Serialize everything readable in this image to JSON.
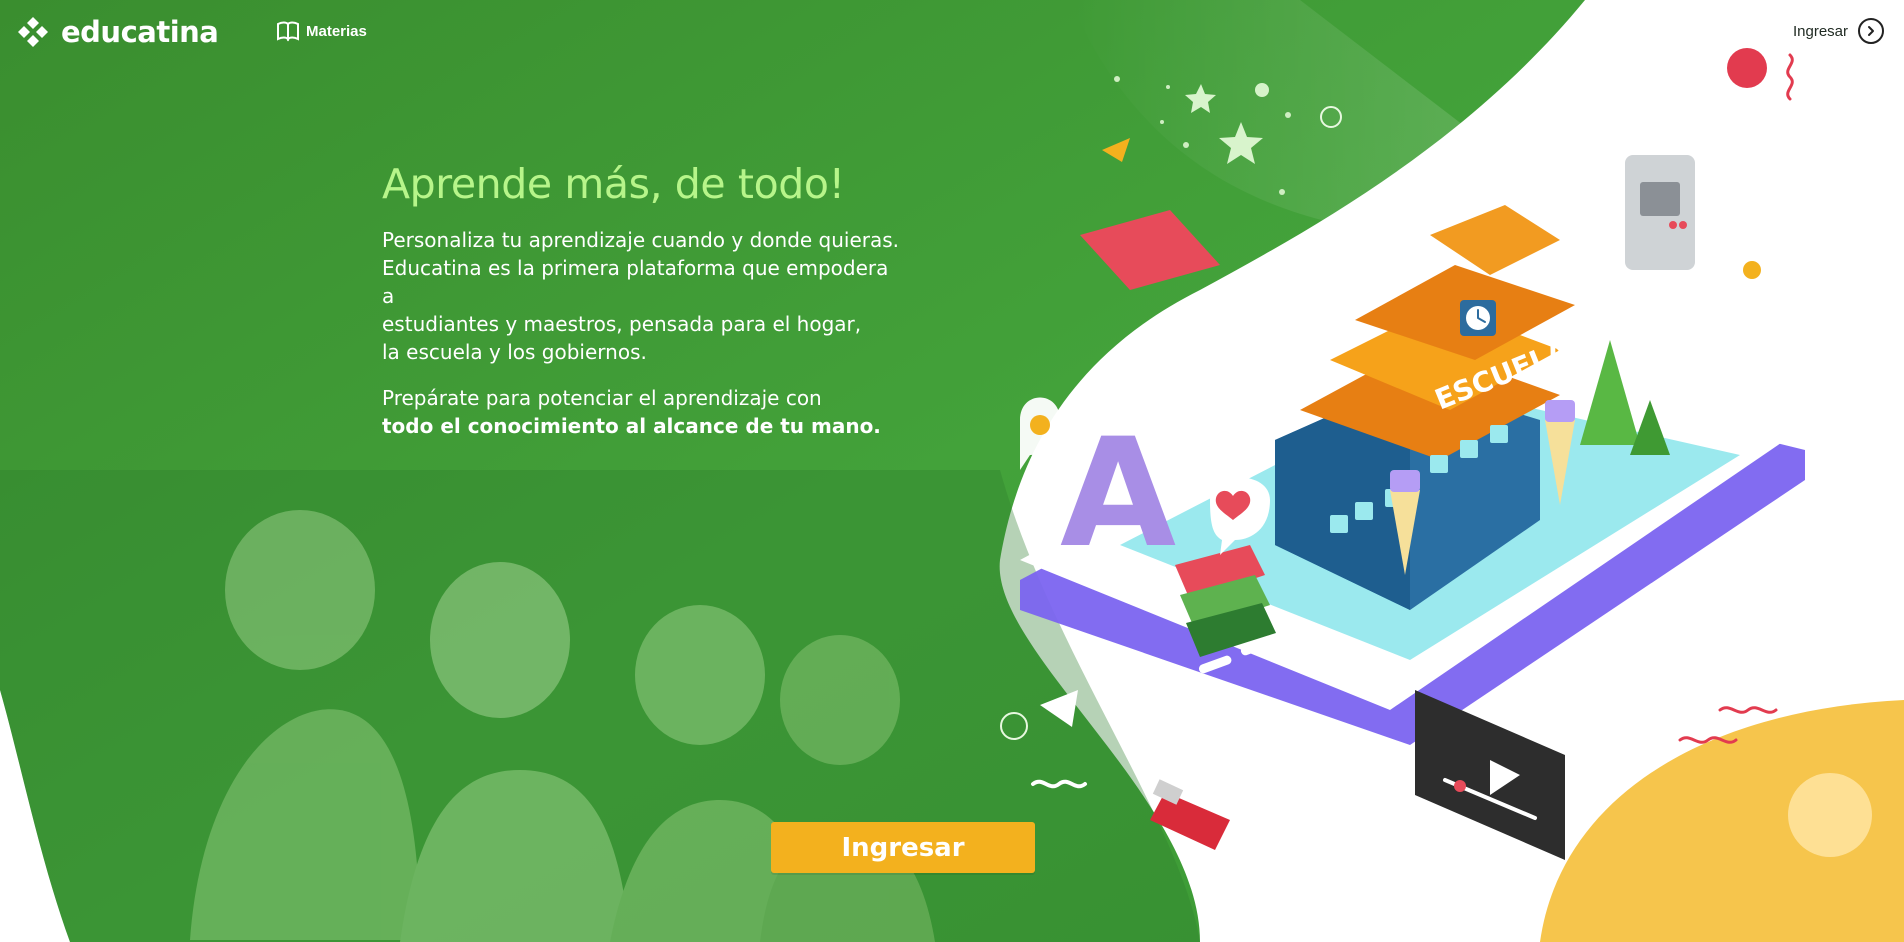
{
  "header": {
    "brand": "educatina",
    "nav_materias": "Materias",
    "login_label": "Ingresar"
  },
  "hero": {
    "title": "Aprende más, de todo!",
    "description_lines": [
      "Personaliza tu aprendizaje cuando y donde quieras.",
      "Educatina es la primera plataforma que empodera a",
      "estudiantes y maestros, pensada para el hogar,",
      "la escuela y los gobiernos."
    ],
    "prep_line": "Prepárate para potenciar el aprendizaje con",
    "prep_strong": "todo el conocimiento al alcance de tu mano.",
    "cta_label": "Ingresar"
  },
  "illustration": {
    "school_sign": "ESCUELA",
    "letter": "A"
  },
  "colors": {
    "green_dark": "#2f7e2f",
    "green_mid": "#46a23b",
    "title_green": "#b7f58a",
    "cta_yellow": "#f3b11e",
    "school_orange": "#e77f13"
  },
  "icons": {
    "brand": "educatina-logo-icon",
    "materias": "book-open-icon",
    "login": "chevron-right-circle-icon"
  }
}
